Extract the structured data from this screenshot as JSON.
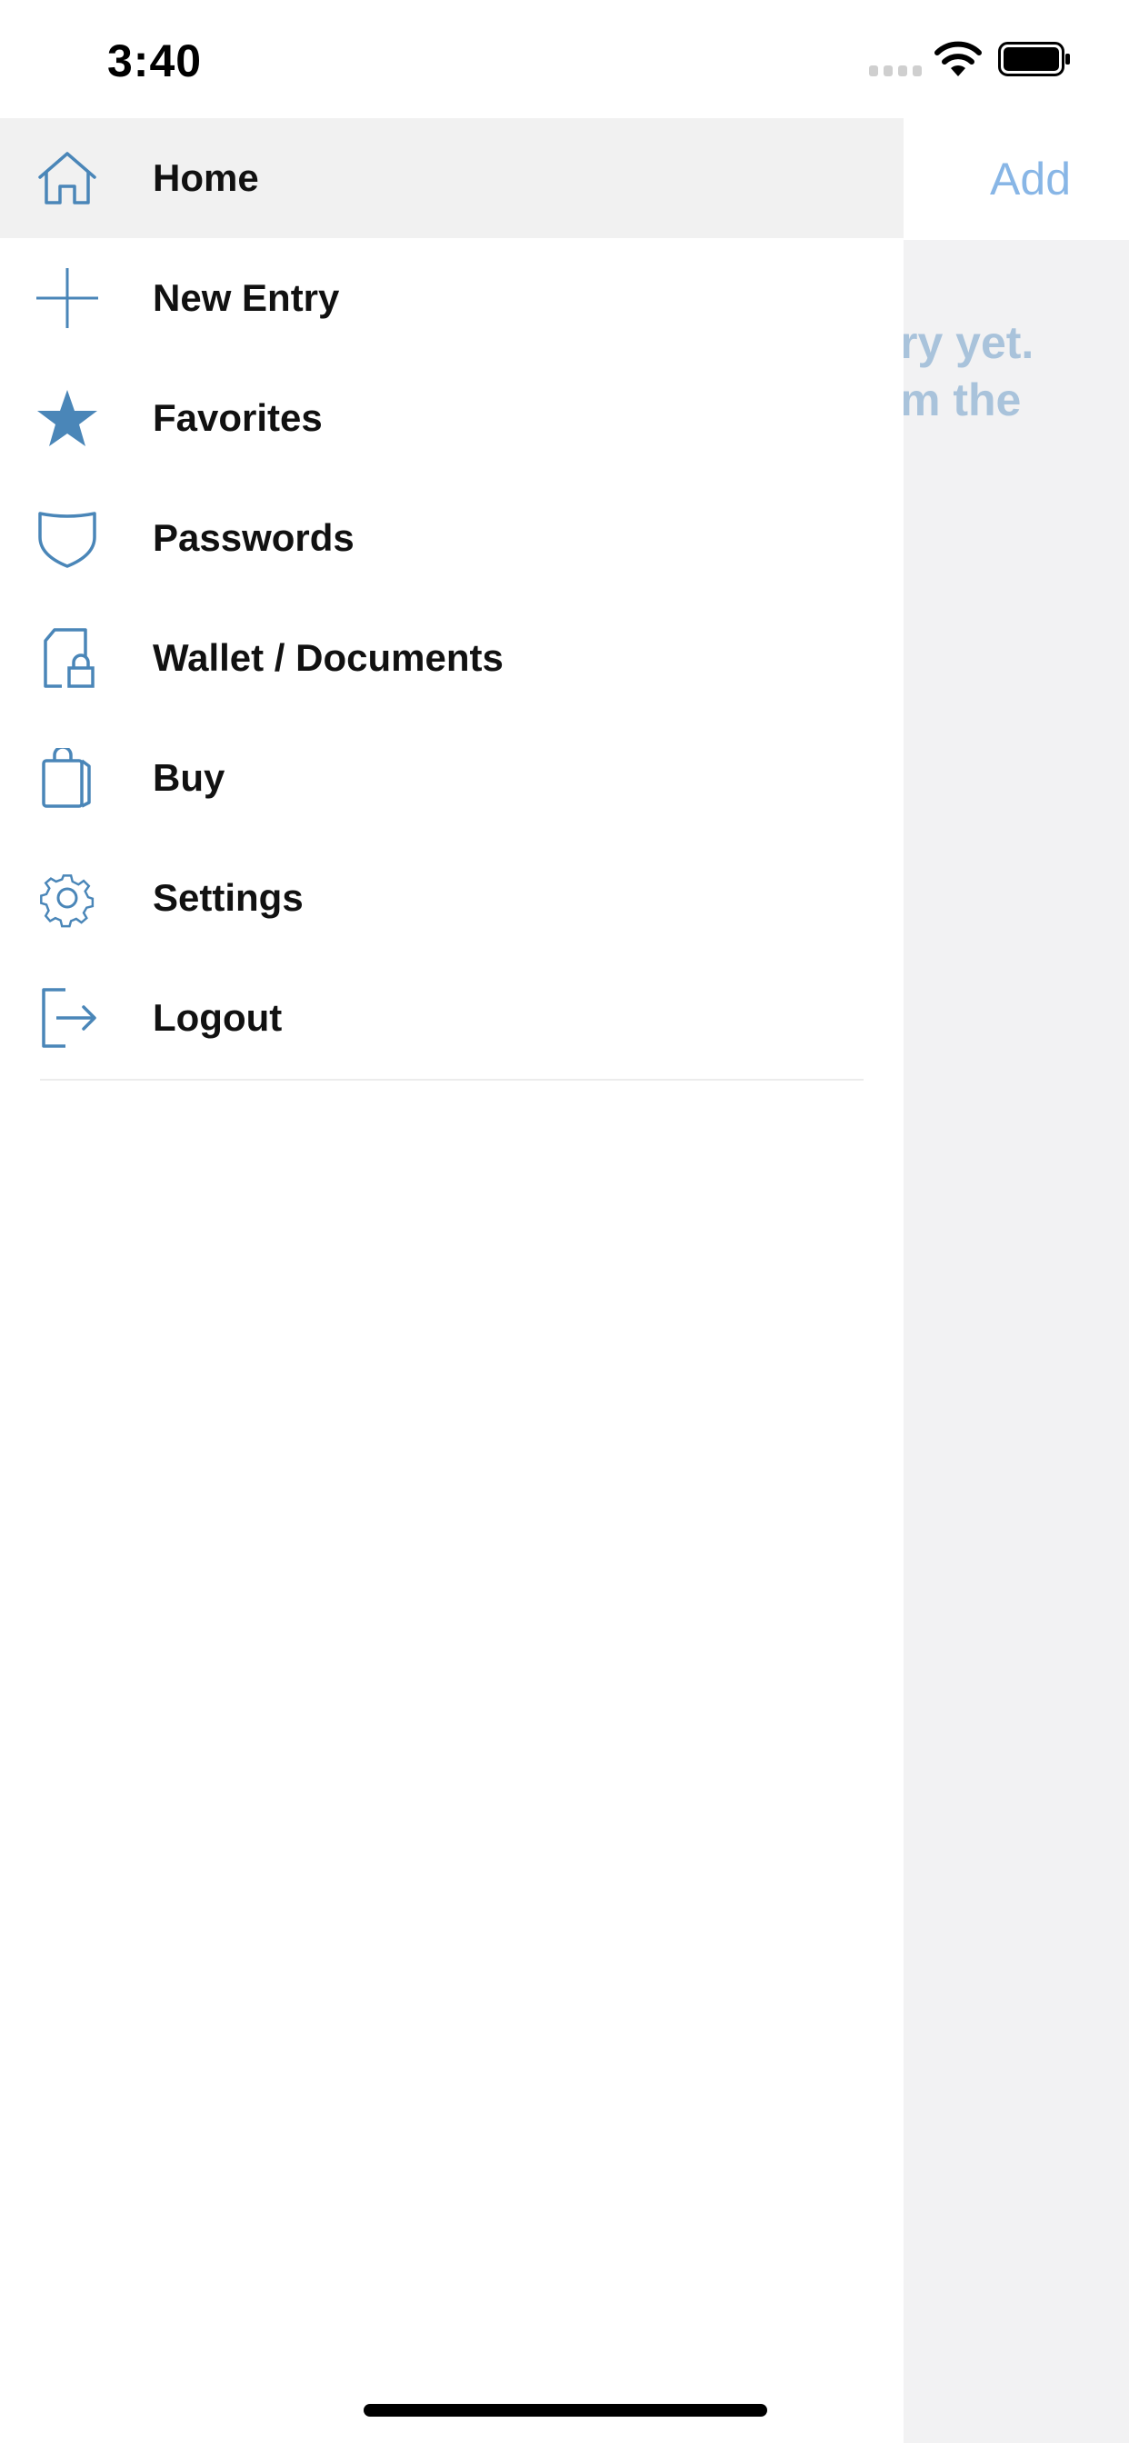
{
  "status_bar": {
    "time": "3:40"
  },
  "background": {
    "nav_action": "Add",
    "empty_text_line1": "ry yet.",
    "empty_text_line2": "m the"
  },
  "colors": {
    "accent": "#4a86b8",
    "active_row": "#f1f1f1"
  },
  "menu": {
    "items": [
      {
        "label": "Home",
        "icon": "home-icon",
        "active": true
      },
      {
        "label": "New Entry",
        "icon": "plus-icon"
      },
      {
        "label": "Favorites",
        "icon": "star-icon"
      },
      {
        "label": "Passwords",
        "icon": "shield-icon"
      },
      {
        "label": "Wallet / Documents",
        "icon": "document-lock-icon"
      },
      {
        "label": "Buy",
        "icon": "shopping-bag-icon"
      },
      {
        "label": "Settings",
        "icon": "gear-icon"
      },
      {
        "label": "Logout",
        "icon": "logout-icon"
      }
    ]
  }
}
